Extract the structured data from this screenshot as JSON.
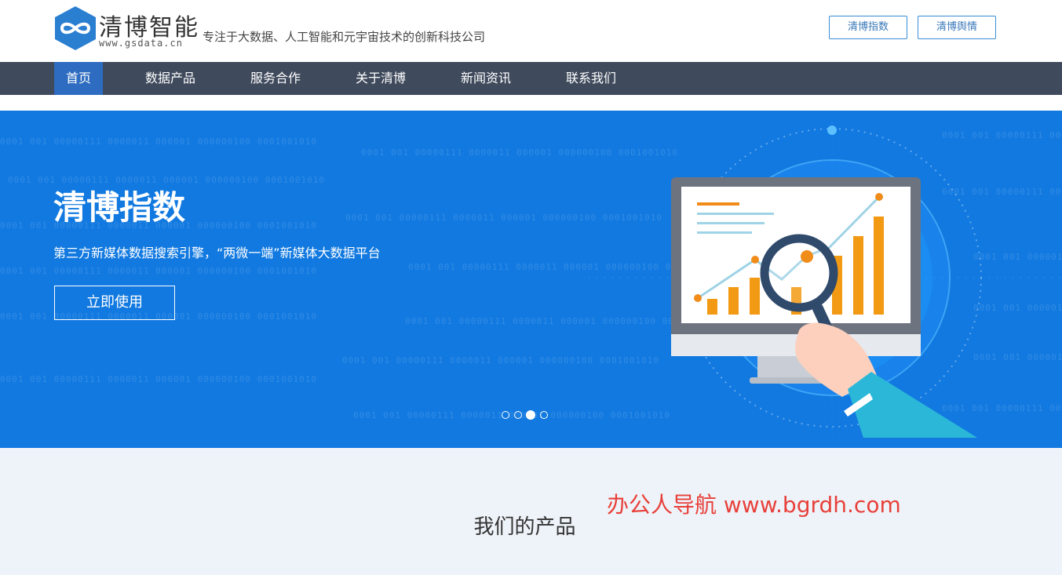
{
  "header": {
    "brand": "清博智能",
    "domain": "www.gsdata.cn",
    "slogan": "专注于大数据、人工智能和元宇宙技术的创新科技公司",
    "buttons": [
      "清博指数",
      "清博舆情"
    ]
  },
  "nav": {
    "items": [
      "首页",
      "数据产品",
      "服务合作",
      "关于清博",
      "新闻资讯",
      "联系我们"
    ],
    "active_index": 0
  },
  "banner": {
    "title": "清博指数",
    "subtitle": "第三方新媒体数据搜索引擎，“两微一端”新媒体大数据平台",
    "cta": "立即使用",
    "slide_count": 4,
    "active_slide": 3,
    "binary_text": "0001 001 00000111 0000011 000001 000000100 0001001010"
  },
  "products": {
    "title": "我们的产品",
    "watermark": "办公人导航  www.bgrdh.com"
  },
  "colors": {
    "nav_bg": "#3f4a5c",
    "nav_active": "#2d6cc0",
    "banner_bg": "#1179e0",
    "watermark": "#e8403a"
  }
}
